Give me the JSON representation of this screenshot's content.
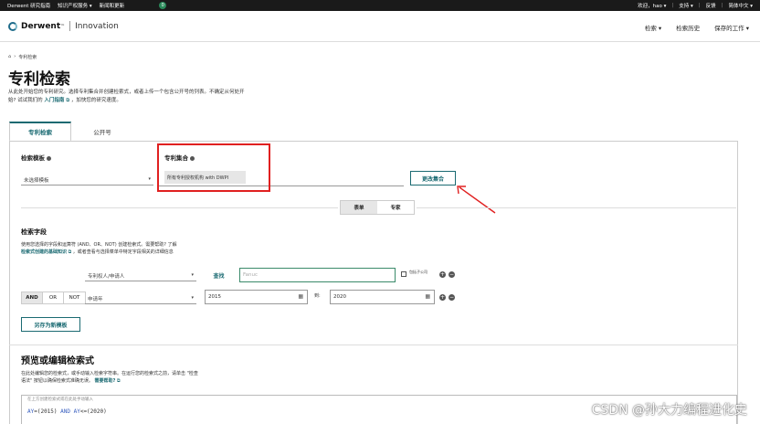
{
  "topbar": {
    "left": [
      "Derwent 研究指南",
      "知识产权服务 ▾",
      "新闻和更新"
    ],
    "bubble": "0",
    "right": [
      "欢迎，hao ▾",
      "支持 ▾",
      "反馈",
      "简体中文 ▾"
    ]
  },
  "header": {
    "brand": "Derwent",
    "brand_mark": "™",
    "product": "Innovation",
    "nav": [
      "检索 ▾",
      "检索历史",
      "保存的工作 ▾"
    ]
  },
  "breadcrumb": {
    "home_icon": "home-icon",
    "sep": "›",
    "current": "专利检索"
  },
  "page": {
    "title": "专利检索",
    "subtitle_1": "从此处开始您的专利研究。选择专利集合并创建检索式，或者上传一个包含公开号的列表。不确定从何处开",
    "subtitle_2": "始? 试试我们的",
    "subtitle_link": "入门指南",
    "subtitle_3": "，加快您的研究速度。"
  },
  "tabs": [
    "专利检索",
    "公开号"
  ],
  "template": {
    "label": "检索模板",
    "value": "未选择模板"
  },
  "collection": {
    "label": "专利集合",
    "chip": "所有专利授权机构 with DWPI",
    "change_button": "更改集合"
  },
  "mode_toggle": [
    "表单",
    "专家"
  ],
  "fields": {
    "label": "检索字段",
    "desc_1": "使用您选择的字段和运算符 (AND、OR、NOT) 创建检索式。需要帮助? 了解",
    "desc_link": "检索式创建的基础知识",
    "desc_2": "，或者查看与选择菜单中特定字段相关的详细信息",
    "row1": {
      "field": "专利权人/申请人",
      "lookup": "查找",
      "value": "Fanuc",
      "checkbox_label": "包括子公司"
    },
    "ops": [
      "AND",
      "OR",
      "NOT"
    ],
    "ops_selected": "AND",
    "row2": {
      "field": "申请年",
      "from": "2015",
      "to_label": "到:",
      "to": "2020"
    },
    "save_template": "另存为新模板"
  },
  "preview": {
    "title": "预览或编辑检索式",
    "desc_1": "在此处编辑您的检索式，或手动输入检索字符串。在运行您的检索式之前，请单击 \"检查",
    "desc_2": "语法\" 按钮以确保检索式准确无误。",
    "help": "需要帮助?",
    "hint": "在上方创建检索式或在此处手动输入",
    "query_a": "AY",
    "query_b": "=(2015) ",
    "query_and": "AND",
    "query_c": " AY",
    "query_d": "<=(2020)"
  },
  "watermark": "CSDN @孙大力编程进化史"
}
